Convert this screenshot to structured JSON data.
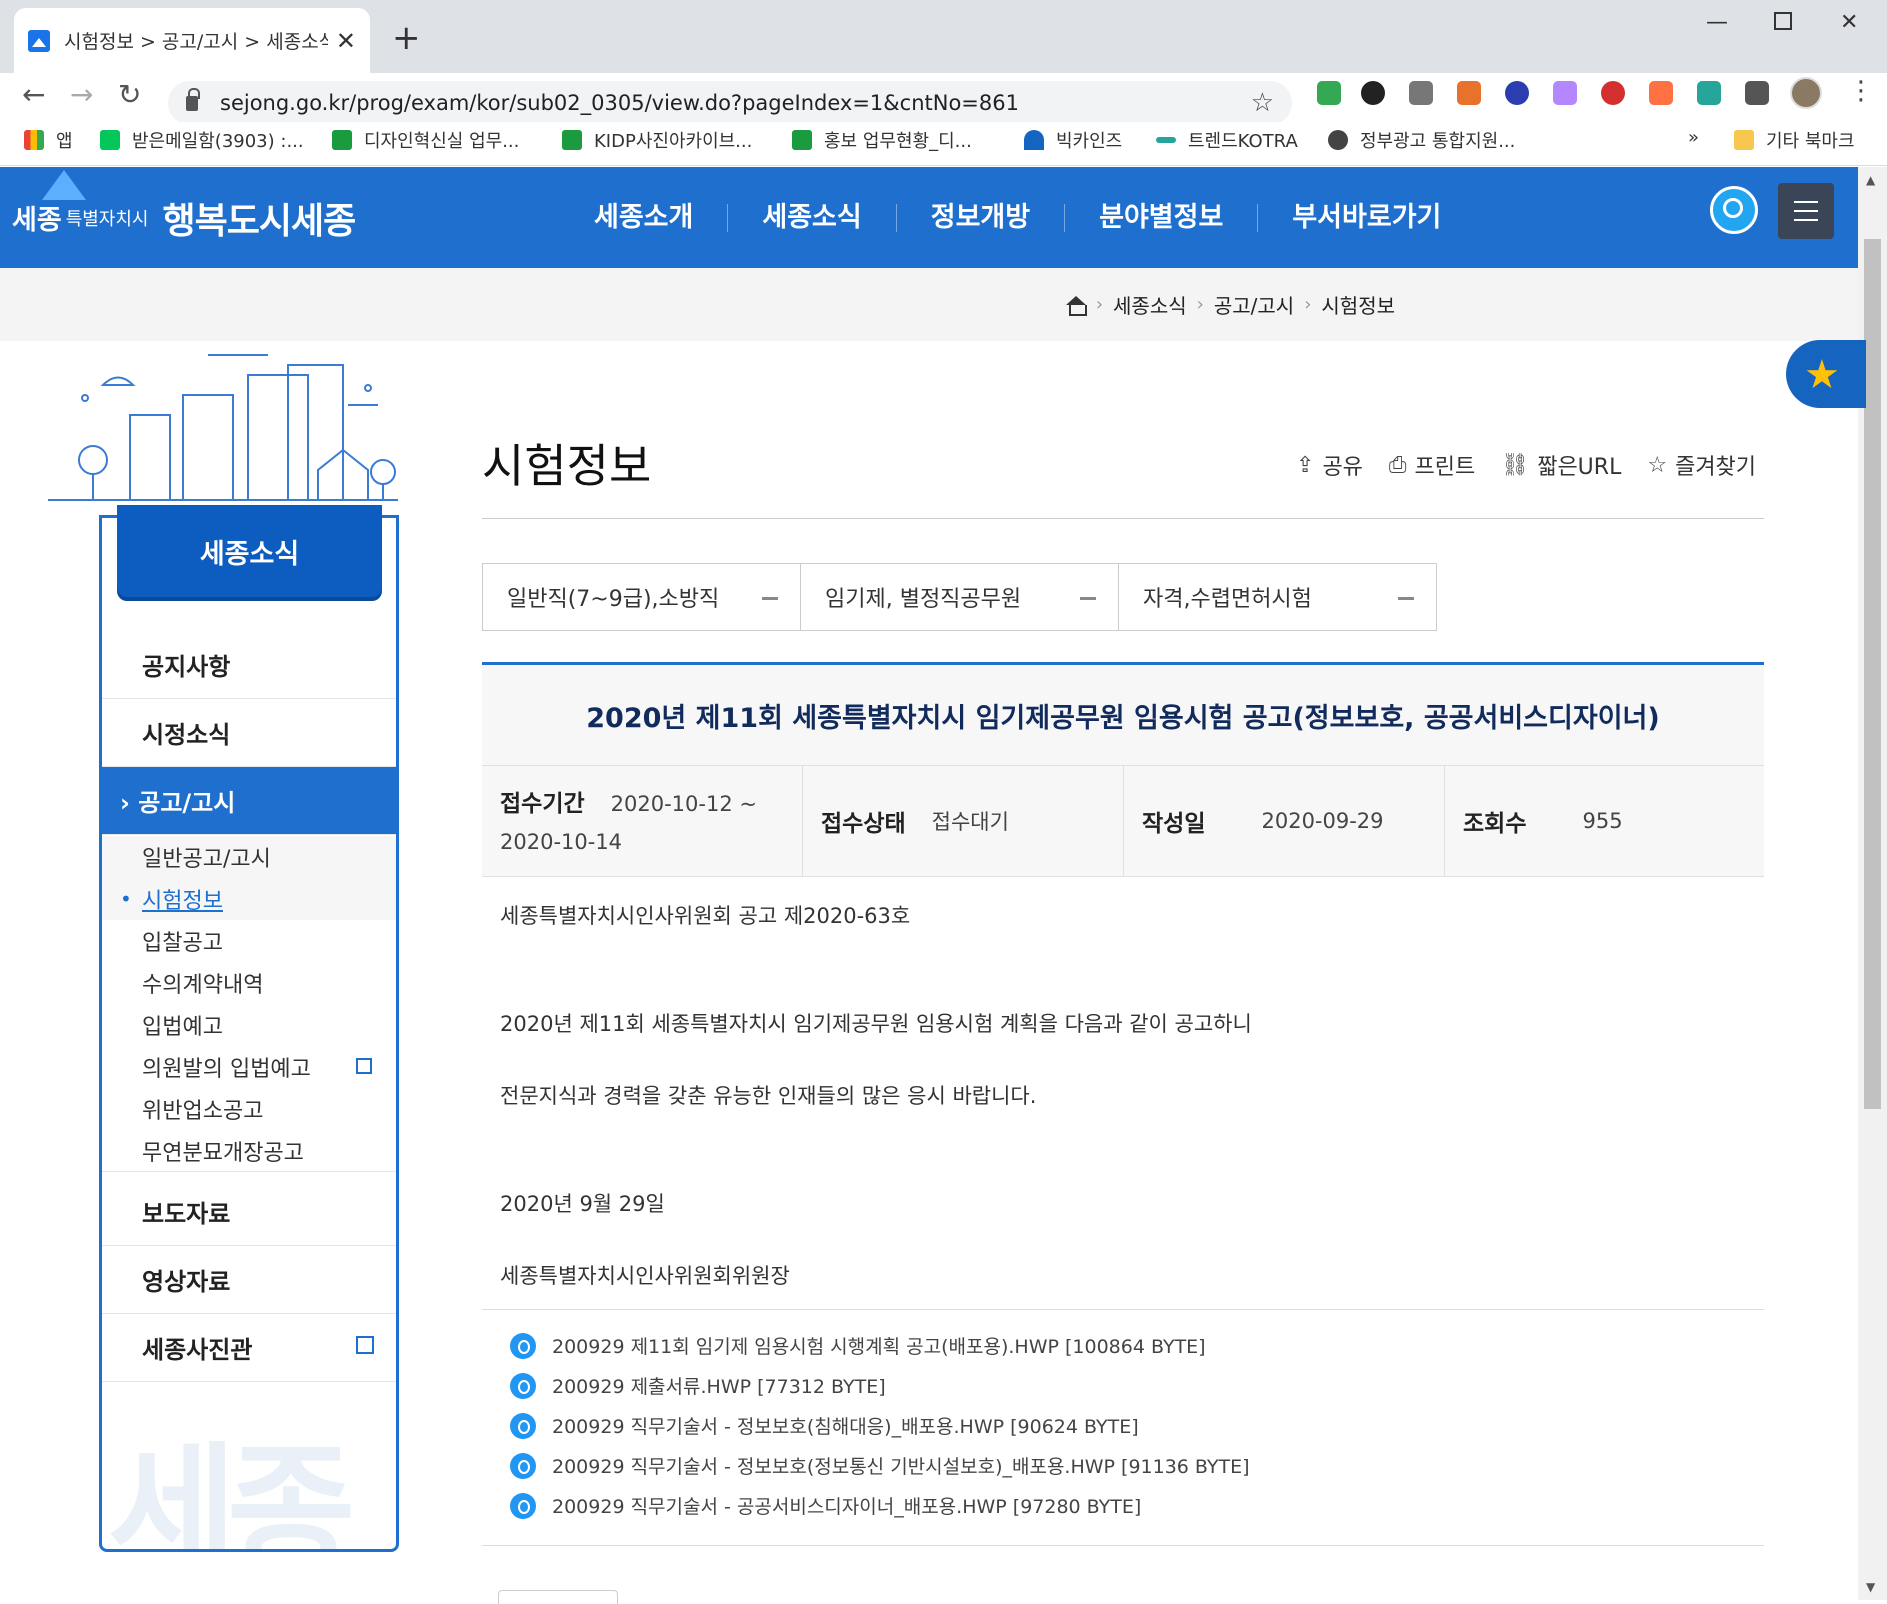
{
  "browser": {
    "tab_title": "시험정보 > 공고/고시 > 세종소식",
    "url": "sejong.go.kr/prog/exam/kor/sub02_0305/view.do?pageIndex=1&cntNo=861",
    "bookmarks": [
      "앱",
      "받은메일함(3903) :...",
      "디자인혁신실 업무...",
      "KIDP사진아카이브...",
      "홍보 업무현황_디...",
      "빅카인즈",
      "트렌드KOTRA",
      "정부광고 통합지원...",
      "»",
      "기타 북마크"
    ]
  },
  "site": {
    "logo_mark": "세종",
    "logo_small": "특별자치시",
    "logo_big": "행복도시세종",
    "gnb": [
      "세종소개",
      "세종소식",
      "정보개방",
      "분야별정보",
      "부서바로가기"
    ]
  },
  "breadcrumb": [
    "세종소식",
    "공고/고시",
    "시험정보"
  ],
  "lnb": {
    "title": "세종소식",
    "items": [
      "공지사항",
      "시정소식",
      "공고/고시",
      "보도자료",
      "영상자료",
      "세종사진관"
    ],
    "active_label": "› 공고/고시",
    "subitems": [
      "일반공고/고시",
      "시험정보",
      "입찰공고",
      "수의계약내역",
      "입법예고",
      "의원발의 입법예고",
      "위반업소공고",
      "무연분묘개장공고"
    ],
    "watermark": "세종"
  },
  "page": {
    "title": "시험정보",
    "tools": [
      {
        "icon": "share-icon",
        "label": "공유"
      },
      {
        "icon": "print-icon",
        "label": "프린트"
      },
      {
        "icon": "link-icon",
        "label": "짧은URL"
      },
      {
        "icon": "star-icon",
        "label": "즐겨찾기"
      }
    ],
    "categories": [
      "일반직(7~9급),소방직",
      "임기제, 별정직공무원",
      "자격,수렵면허시험"
    ]
  },
  "article": {
    "title": "2020년 제11회 세종특별자치시 임기제공무원 임용시험 공고(정보보호, 공공서비스디자이너)",
    "meta": {
      "period_label": "접수기간",
      "period_start": "2020-10-12 ~",
      "period_end": "2020-10-14",
      "status_label": "접수상태",
      "status_value": "접수대기",
      "date_label": "작성일",
      "date_value": "2020-09-29",
      "views_label": "조회수",
      "views_value": "955"
    },
    "body": [
      "세종특별자치시인사위원회 공고 제2020-63호",
      "2020년 제11회 세종특별자치시 임기제공무원 임용시험 계획을 다음과 같이 공고하니",
      "전문지식과 경력을 갖춘 유능한 인재들의 많은 응시 바랍니다.",
      "2020년 9월 29일",
      "세종특별자치시인사위원회위원장"
    ],
    "files": [
      "200929 제11회 임기제 임용시험 시행계획 공고(배포용).HWP [100864 BYTE]",
      "200929 제출서류.HWP [77312 BYTE]",
      "200929 직무기술서 - 정보보호(침해대응)_배포용.HWP [90624 BYTE]",
      "200929 직무기술서 - 정보보호(정보통신 기반시설보호)_배포용.HWP [91136 BYTE]",
      "200929 직무기술서 - 공공서비스디자이너_배포용.HWP [97280 BYTE]"
    ]
  }
}
